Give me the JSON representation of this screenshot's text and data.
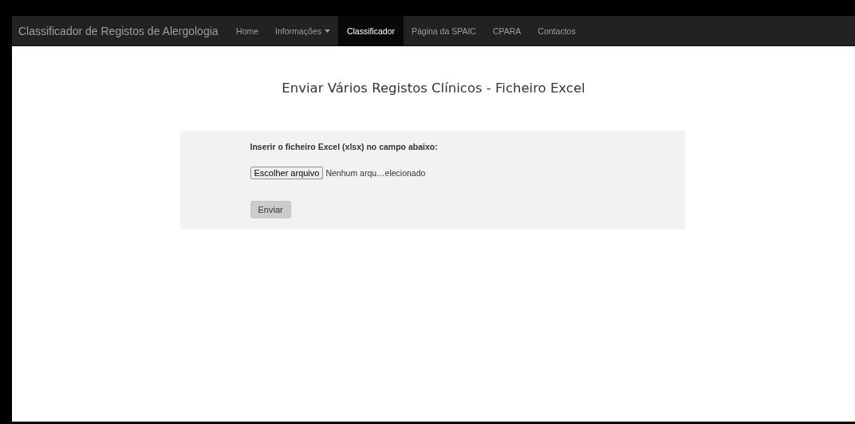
{
  "navbar": {
    "brand": "Classificador de Registos de Alergologia",
    "items": [
      {
        "label": "Home",
        "selected": false,
        "dropdown": false
      },
      {
        "label": "Informações",
        "selected": false,
        "dropdown": true
      },
      {
        "label": "Classificador",
        "selected": true,
        "dropdown": false
      },
      {
        "label": "Página da SPAIC",
        "selected": false,
        "dropdown": false
      },
      {
        "label": "CPARA",
        "selected": false,
        "dropdown": false
      },
      {
        "label": "Contactos",
        "selected": false,
        "dropdown": false
      }
    ]
  },
  "heading": "Enviar Vários Registos Clínicos - Ficheiro Excel",
  "form": {
    "label": "Inserir o ficheiro Excel (xlsx) no campo abaixo:",
    "file_button": "Escolher arquivo",
    "file_status": "Nenhum arqu…elecionado",
    "submit": "Enviar"
  }
}
